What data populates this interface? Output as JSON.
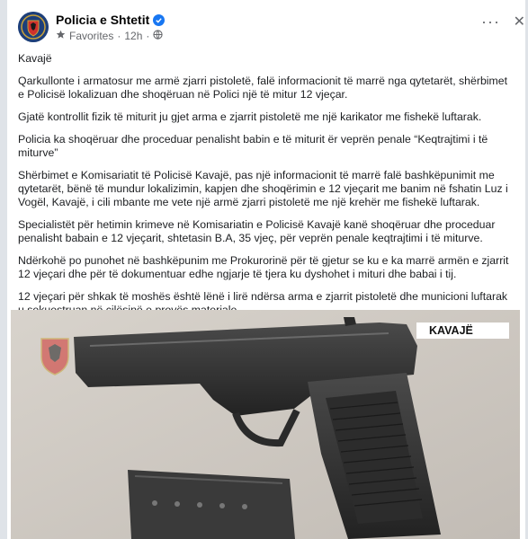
{
  "post": {
    "page_name": "Policia e Shtetit",
    "audience": "Favorites",
    "time": "12h",
    "verified_icon": "verified-badge-icon",
    "paragraphs": [
      "Kavajë",
      "Qarkullonte i armatosur me armë zjarri pistoletë, falë informacionit të marrë nga qytetarët, shërbimet e Policisë lokalizuan dhe shoqëruan në Polici një të mitur 12 vjeçar.",
      "Gjatë kontrollit fizik të miturit ju gjet arma e zjarrit pistoletë me një karikator me fishekë luftarak.",
      "Policia ka shoqëruar dhe proceduar penalisht  babin e të miturit ër veprën penale “Keqtrajtimi i të miturve”",
      "Shërbimet e Komisariatit të Policisë Kavajë,  pas një informacionit të marrë falë bashkëpunimit me qytetarët, bënë të mundur lokalizimin, kapjen dhe shoqërimin e  12 vjeçarit me banim në fshatin Luz i Vogël, Kavajë, i cili mbante me vete një armë zjarri pistoletë me një krehër me fishekë luftarak.",
      "Specialistët për hetimin  krimeve në Komisariatin e Policisë Kavajë kanë shoqëruar dhe proceduar penalisht babain e 12 vjeçarit, shtetasin B.A, 35 vjeç,  për veprën penale keqtrajtimi i të miturve.",
      "Ndërkohë  po punohet në bashkëpunim me Prokurorinë për të gjetur se ku e ka marrë armën e zjarrit 12 vjeçari dhe për të dokumentuar edhe ngjarje të tjera ku dyshohet i mituri dhe babai i tij.",
      "12 vjeçari për shkak të moshës është lënë i lirë ndërsa arma e zjarrit pistoletë dhe municioni luftarak u sekuestruan në cilësinë e provës materiale."
    ],
    "photo_label": "KAVAJË"
  },
  "icons": {
    "more": "more-options-icon",
    "close": "close-icon",
    "audience": "star-icon"
  },
  "colors": {
    "brand_blue": "#1877f2",
    "avatar_bg": "#1d3f7a",
    "meta_gray": "#65676b"
  }
}
